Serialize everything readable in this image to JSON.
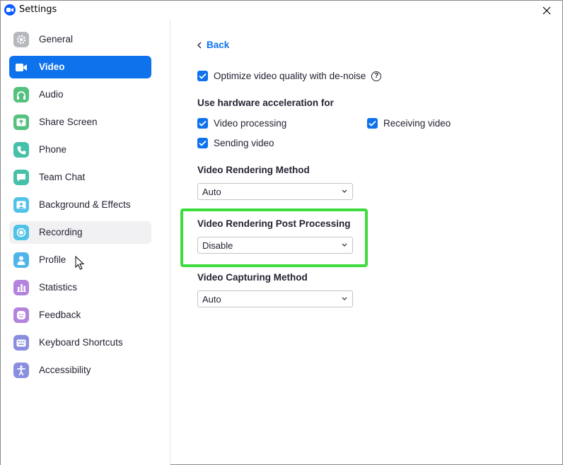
{
  "window": {
    "title": "Settings"
  },
  "sidebar": {
    "items": [
      {
        "label": "General",
        "icon": "gear-icon",
        "color": "#9aa0a6",
        "state": ""
      },
      {
        "label": "Video",
        "icon": "video-icon",
        "color": "#0e72ed",
        "state": "active"
      },
      {
        "label": "Audio",
        "icon": "headphones-icon",
        "color": "#3fb968",
        "state": ""
      },
      {
        "label": "Share Screen",
        "icon": "share-screen-icon",
        "color": "#3fb968",
        "state": ""
      },
      {
        "label": "Phone",
        "icon": "phone-icon",
        "color": "#36b3a8",
        "state": ""
      },
      {
        "label": "Team Chat",
        "icon": "chat-icon",
        "color": "#36b3a8",
        "state": ""
      },
      {
        "label": "Background & Effects",
        "icon": "background-icon",
        "color": "#3ab1dd",
        "state": ""
      },
      {
        "label": "Recording",
        "icon": "record-icon",
        "color": "#3ab1dd",
        "state": "hover"
      },
      {
        "label": "Profile",
        "icon": "profile-icon",
        "color": "#3ab1dd",
        "state": ""
      },
      {
        "label": "Statistics",
        "icon": "statistics-icon",
        "color": "#a576d6",
        "state": ""
      },
      {
        "label": "Feedback",
        "icon": "feedback-icon",
        "color": "#a576d6",
        "state": ""
      },
      {
        "label": "Keyboard Shortcuts",
        "icon": "keyboard-icon",
        "color": "#7b7fd4",
        "state": ""
      },
      {
        "label": "Accessibility",
        "icon": "accessibility-icon",
        "color": "#7b7fd4",
        "state": ""
      }
    ]
  },
  "content": {
    "back_label": "Back",
    "denoise_label": "Optimize video quality with de-noise",
    "denoise_checked": true,
    "hw_accel_title": "Use hardware acceleration for",
    "video_processing_label": "Video processing",
    "receiving_video_label": "Receiving video",
    "sending_video_label": "Sending video",
    "rendering_method_title": "Video Rendering Method",
    "rendering_method_value": "Auto",
    "post_processing_title": "Video Rendering Post Processing",
    "post_processing_value": "Disable",
    "capturing_method_title": "Video Capturing Method",
    "capturing_method_value": "Auto",
    "help_glyph": "?"
  },
  "colors": {
    "accent": "#0e72ed",
    "highlight": "#3ddc3d"
  }
}
